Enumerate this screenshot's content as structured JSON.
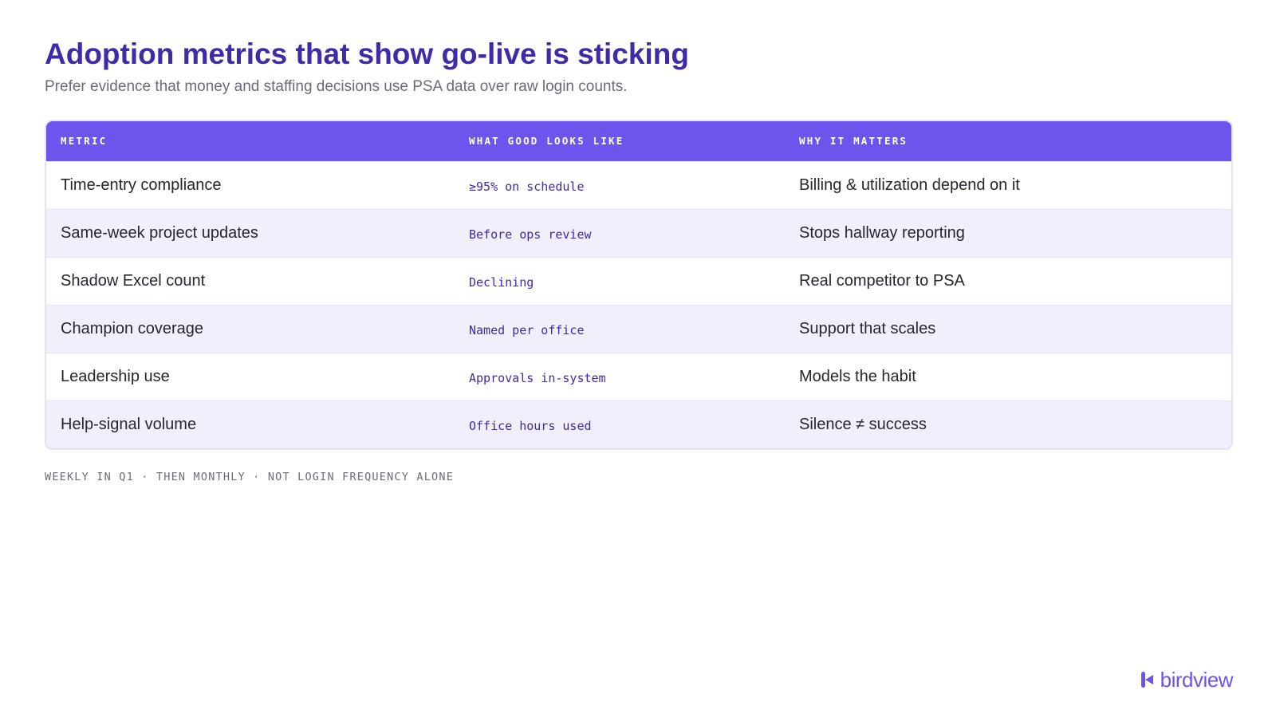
{
  "header": {
    "title": "Adoption metrics that show go-live is sticking",
    "subtitle": "Prefer evidence that money and staffing decisions use PSA data over raw login counts."
  },
  "table": {
    "columns": [
      "METRIC",
      "WHAT GOOD LOOKS LIKE",
      "WHY IT MATTERS"
    ],
    "rows": [
      {
        "metric": "Time-entry compliance",
        "good": "≥95% on schedule",
        "why": "Billing & utilization depend on it"
      },
      {
        "metric": "Same-week project updates",
        "good": "Before ops review",
        "why": "Stops hallway reporting"
      },
      {
        "metric": "Shadow Excel count",
        "good": "Declining",
        "why": "Real competitor to PSA"
      },
      {
        "metric": "Champion coverage",
        "good": "Named per office",
        "why": "Support that scales"
      },
      {
        "metric": "Leadership use",
        "good": "Approvals in-system",
        "why": "Models the habit"
      },
      {
        "metric": "Help-signal volume",
        "good": "Office hours used",
        "why": "Silence ≠ success"
      }
    ]
  },
  "footnote": "WEEKLY IN Q1 · THEN MONTHLY · NOT LOGIN FREQUENCY ALONE",
  "logo": {
    "text": "birdview",
    "icon": "birdview-logo-icon",
    "color": "#6c55ec"
  },
  "colors": {
    "title": "#3f2aa8",
    "header_bg": "#6c55ec",
    "row_alt_bg": "#f1effc"
  }
}
